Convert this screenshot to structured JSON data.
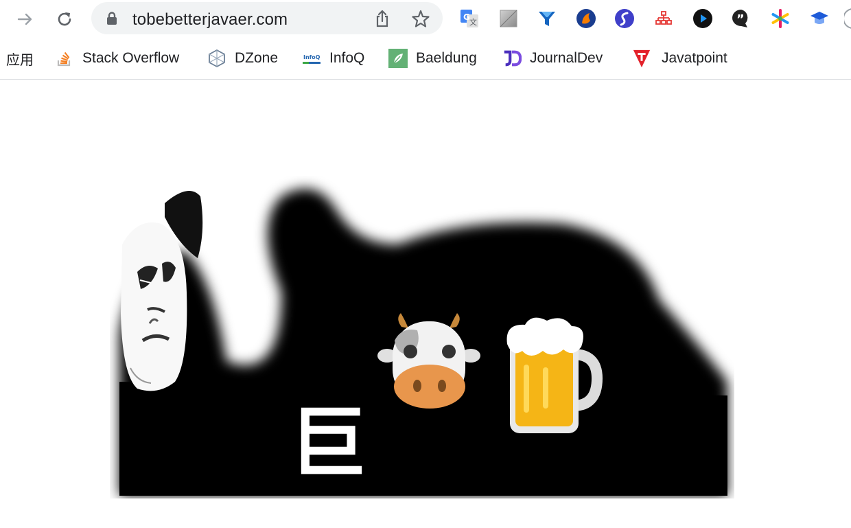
{
  "browser": {
    "url": "tobebetterjavaer.com",
    "bookmarks": {
      "apps": "应用",
      "items": [
        {
          "label": "Stack Overflow"
        },
        {
          "label": "DZone"
        },
        {
          "label": "InfoQ"
        },
        {
          "label": "Baeldung"
        },
        {
          "label": "JournalDev"
        },
        {
          "label": "Javatpoint"
        }
      ]
    },
    "extensions": [
      "translate-icon",
      "placeholder-extension-icon",
      "funnel-icon",
      "fox-icon",
      "s-logo-icon",
      "sitemap-icon",
      "play-icon",
      "quote-icon",
      "asterisk-icon",
      "graduation-cap-icon"
    ]
  },
  "content": {
    "meme_text": "巨",
    "emojis": [
      "cow-face",
      "beer-mug"
    ]
  }
}
